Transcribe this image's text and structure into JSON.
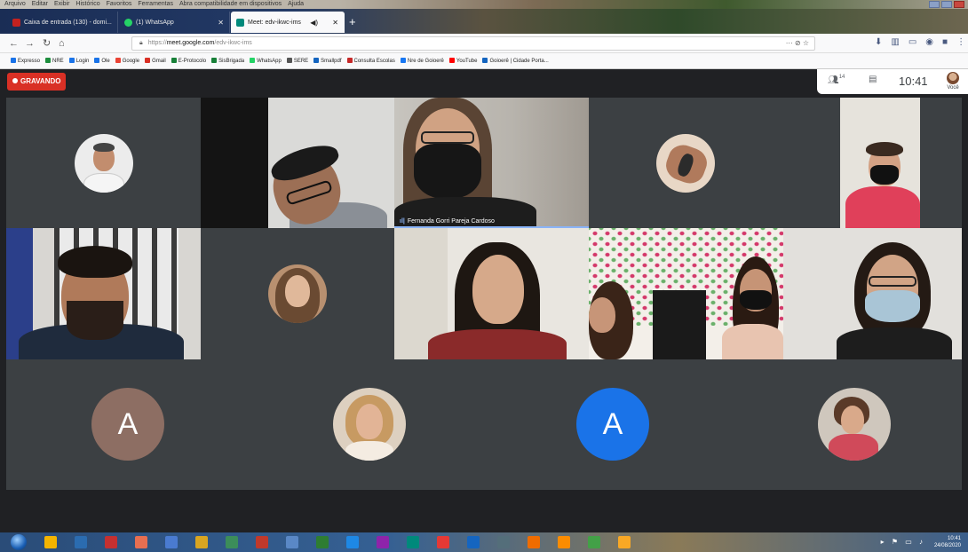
{
  "menu": {
    "items": [
      "Arquivo",
      "Editar",
      "Exibir",
      "Histórico",
      "Favoritos",
      "Ferramentas",
      "Abra compatibilidade em dispositivos",
      "Ajuda"
    ]
  },
  "tabs": [
    {
      "label": "Caixa de entrada (130) - domi...",
      "color": "#c5221f"
    },
    {
      "label": "(1) WhatsApp",
      "color": "#25d366"
    },
    {
      "label": "Meet: edv-ikwc-ims",
      "color": "#00897b"
    }
  ],
  "nav": {
    "url_prefix": "https://",
    "url_domain": "meet.google.com",
    "url_path": "/edv-ikwc-ims",
    "url_right": "··· ⊘ ☆"
  },
  "bookmarks": [
    {
      "label": "Expresso",
      "color": "#1a73e8"
    },
    {
      "label": "NRE",
      "color": "#1e8e3e"
    },
    {
      "label": "Login",
      "color": "#1a73e8"
    },
    {
      "label": "Ole",
      "color": "#1a73e8"
    },
    {
      "label": "Google",
      "color": "#ea4335"
    },
    {
      "label": "Gmail",
      "color": "#d93025"
    },
    {
      "label": "E-Protocolo",
      "color": "#188038"
    },
    {
      "label": "SisBrigada",
      "color": "#188038"
    },
    {
      "label": "WhatsApp",
      "color": "#25d366"
    },
    {
      "label": "SERE",
      "color": "#555555"
    },
    {
      "label": "Smallpdf",
      "color": "#1565c0"
    },
    {
      "label": "Consulta Escolas",
      "color": "#c62828"
    },
    {
      "label": "Nre de Goioerê",
      "color": "#1877f2"
    },
    {
      "label": "YouTube",
      "color": "#ff0000"
    },
    {
      "label": "Goioerê | Cidade Porta...",
      "color": "#1565c0"
    }
  ],
  "meet": {
    "recording_label": "GRAVANDO",
    "participants_count": "14",
    "time": "10:41",
    "self_label": "Você",
    "speaker_name": "Fernanda Gorri Pareja Cardoso",
    "letter_avatar_1": "A",
    "letter_avatar_2": "A",
    "letter_colors": [
      "#8d6e63",
      "#1a73e8"
    ]
  },
  "taskbar": {
    "time": "10:41",
    "date": "24/08/2020"
  }
}
